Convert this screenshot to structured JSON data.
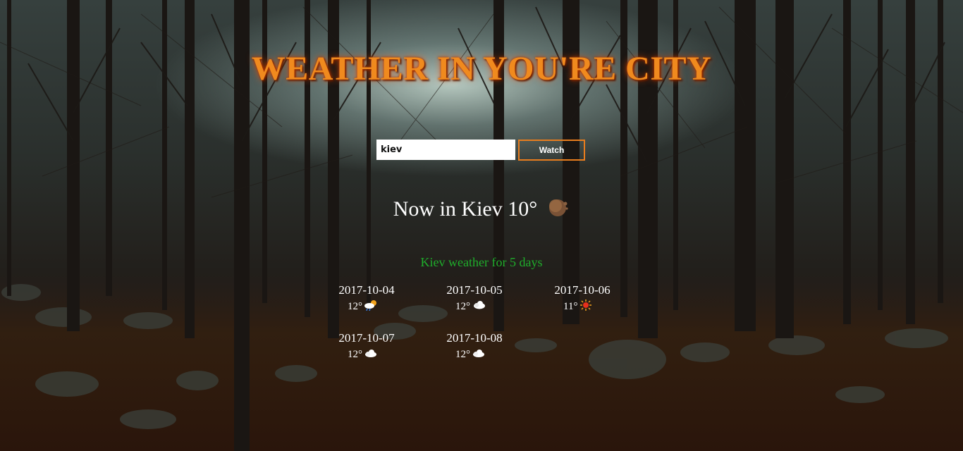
{
  "header": {
    "title": "WEATHER IN YOU'RE CITY"
  },
  "search": {
    "value": "kiev",
    "button_label": "Watch"
  },
  "current": {
    "text": "Now in Kiev 10°",
    "icon": "moon-cloud-icon"
  },
  "forecast": {
    "title": "Kiev weather for 5 days",
    "days": [
      {
        "date": "2017-10-04",
        "temp": "12°",
        "icon": "sun-cloud-rain-icon"
      },
      {
        "date": "2017-10-05",
        "temp": "12°",
        "icon": "cloud-icon"
      },
      {
        "date": "2017-10-06",
        "temp": "11°",
        "icon": "sun-icon"
      },
      {
        "date": "2017-10-07",
        "temp": "12°",
        "icon": "cloud-icon"
      },
      {
        "date": "2017-10-08",
        "temp": "12°",
        "icon": "cloud-icon"
      }
    ]
  },
  "colors": {
    "accent": "#f08a1e",
    "forecast_title": "#1fae2b",
    "button_border": "#e87d1e"
  }
}
